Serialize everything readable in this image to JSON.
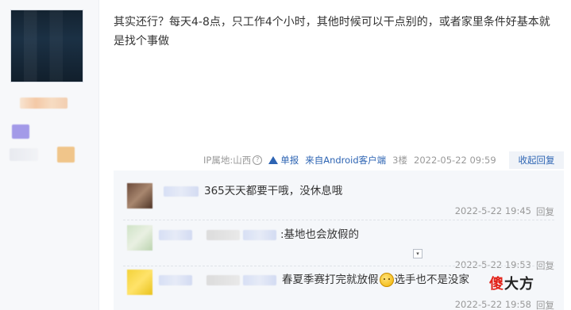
{
  "post": {
    "content": "其实还行？每天4-8点，只工作4个小时，其他时候可以干点别的，或者家里条件好基本就是找个事做",
    "meta": {
      "ip_label": "IP属地:山西",
      "report": "单报",
      "client": "来自Android客户端",
      "floor": "3楼",
      "time": "2022-05-22 09:59"
    },
    "reply_toggle": "收起回复"
  },
  "sub_replies": [
    {
      "text": "365天天都要干哦，没休息哦",
      "time": "2022-5-22 19:45",
      "reply": "回复"
    },
    {
      "text": ":基地也会放假的",
      "time": "2022-5-22 19:53",
      "reply": "回复"
    },
    {
      "text_before": "春夏季赛打完就放假",
      "emoji": "emoji-icon",
      "text_after": "选手也不是没家",
      "time": "2022-5-22 19:58",
      "reply": "回复"
    }
  ],
  "dropdown_icon": "▾",
  "watermark": {
    "part1": "傻",
    "part2": "大方"
  },
  "colors": {
    "link": "#2d64b3",
    "meta_gray": "#999999",
    "panel_bg": "#f5f7fa",
    "watermark_red": "#e2231a"
  }
}
